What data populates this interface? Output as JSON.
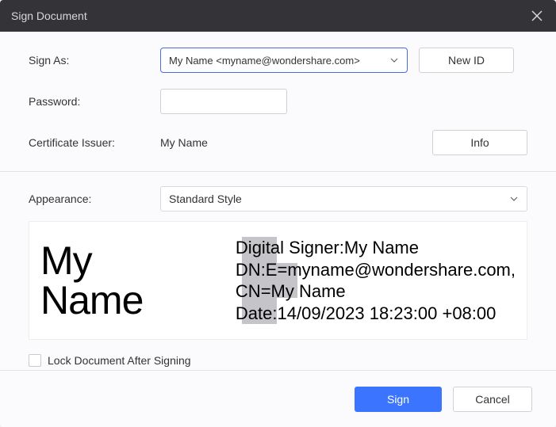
{
  "titlebar": {
    "title": "Sign Document"
  },
  "form": {
    "sign_as_label": "Sign As:",
    "sign_as_value": "My Name <myname@wondershare.com>",
    "new_id_label": "New ID",
    "password_label": "Password:",
    "password_value": "",
    "issuer_label": "Certificate Issuer:",
    "issuer_value": "My Name",
    "info_label": "Info",
    "appearance_label": "Appearance:",
    "appearance_value": "Standard Style"
  },
  "preview": {
    "name": "My Name",
    "line1": "Digital Signer:My Name",
    "line2": "DN:E=myname@wondershare.com, CN=My Name",
    "line3": "Date:14/09/2023 18:23:00 +08:00"
  },
  "lock": {
    "label": "Lock Document After Signing"
  },
  "footer": {
    "sign": "Sign",
    "cancel": "Cancel"
  }
}
